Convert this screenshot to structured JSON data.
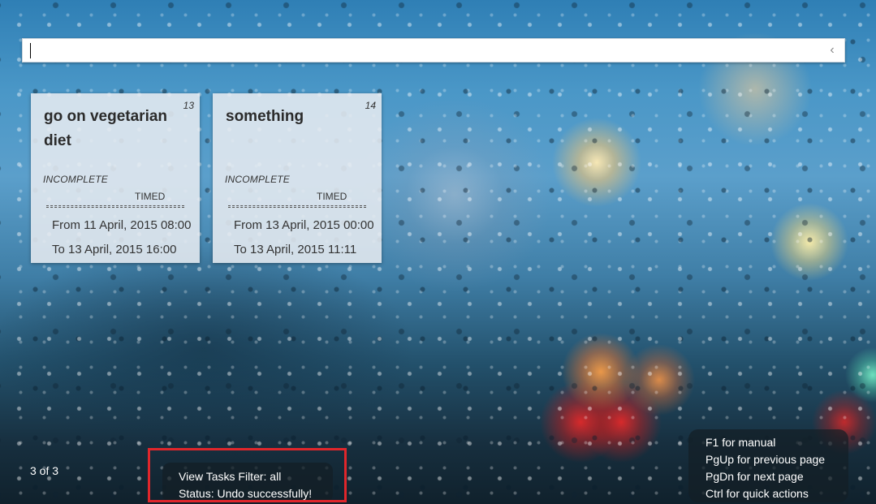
{
  "command_bar": {
    "value": "",
    "placeholder": "",
    "collapse_icon": "chevron-left-icon"
  },
  "tasks": [
    {
      "index": "13",
      "title": "go on vegetarian diet",
      "status": "INCOMPLETE",
      "type": "TIMED",
      "from": "From 11 April, 2015 08:00",
      "to": "To 13 April, 2015 16:00"
    },
    {
      "index": "14",
      "title": "something",
      "status": "INCOMPLETE",
      "type": "TIMED",
      "from": "From 13 April, 2015 00:00",
      "to": "To 13 April, 2015 11:11"
    }
  ],
  "pagination": {
    "label": "3 of 3"
  },
  "status_panel": {
    "filter": "View Tasks Filter: all",
    "status": "Status: Undo successfully!",
    "highlight_color": "#e0262b"
  },
  "help": {
    "manual": "F1 for manual",
    "prev": "PgUp for previous page",
    "next": "PgDn for next page",
    "quick": "Ctrl for quick actions"
  }
}
